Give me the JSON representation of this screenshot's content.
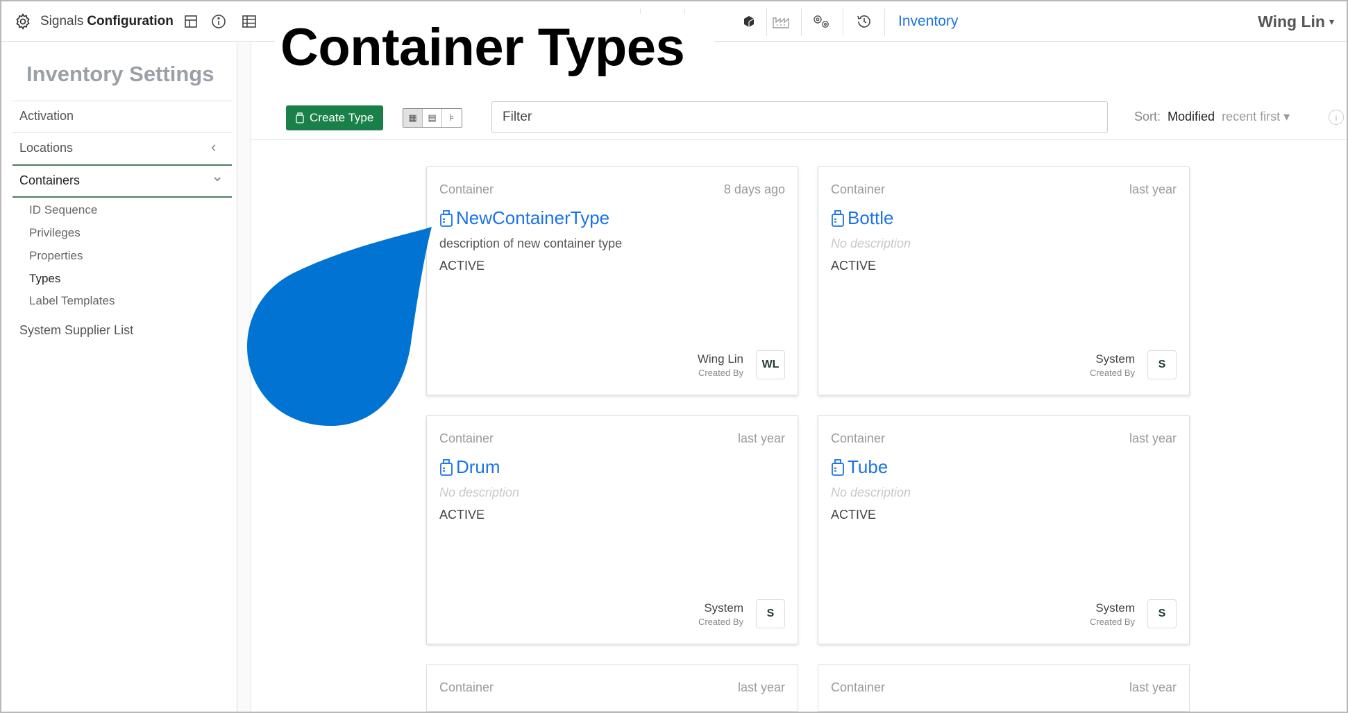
{
  "topbar": {
    "brand_light": "Signals",
    "brand_bold": "Configuration",
    "nav_link": "Inventory",
    "user_name": "Wing Lin",
    "user_caret": "▾"
  },
  "sidebar": {
    "title": "Inventory Settings",
    "items": [
      {
        "label": "Activation"
      },
      {
        "label": "Locations",
        "chevron": "‹"
      },
      {
        "label": "Containers",
        "chevron": "⌄"
      }
    ],
    "sub_items": [
      "ID Sequence",
      "Privileges",
      "Properties",
      "Types",
      "Label Templates"
    ],
    "footer_item": "System Supplier List"
  },
  "overlay": {
    "title": "Container Types"
  },
  "toolbar": {
    "create_label": "Create Type",
    "filter_placeholder": "Filter",
    "sort_label": "Sort:",
    "sort_value": "Modified",
    "sort_direction": "recent first ▾",
    "info": "i"
  },
  "cards": [
    {
      "kind": "Container",
      "time": "8 days ago",
      "name": "NewContainerType",
      "description": "description of new container type",
      "status": "ACTIVE",
      "created_by": "Wing Lin",
      "created_label": "Created By",
      "avatar": "WL"
    },
    {
      "kind": "Container",
      "time": "last year",
      "name": "Bottle",
      "description": "No description",
      "status": "ACTIVE",
      "created_by": "System",
      "created_label": "Created By",
      "avatar": "S"
    },
    {
      "kind": "Container",
      "time": "last year",
      "name": "Drum",
      "description": "No description",
      "status": "ACTIVE",
      "created_by": "System",
      "created_label": "Created By",
      "avatar": "S"
    },
    {
      "kind": "Container",
      "time": "last year",
      "name": "Tube",
      "description": "No description",
      "status": "ACTIVE",
      "created_by": "System",
      "created_label": "Created By",
      "avatar": "S"
    },
    {
      "kind": "Container",
      "time": "last year"
    },
    {
      "kind": "Container",
      "time": "last year"
    }
  ],
  "colors": {
    "accent": "#1a73e8",
    "create_button": "#188048",
    "blob": "#0174d3"
  }
}
